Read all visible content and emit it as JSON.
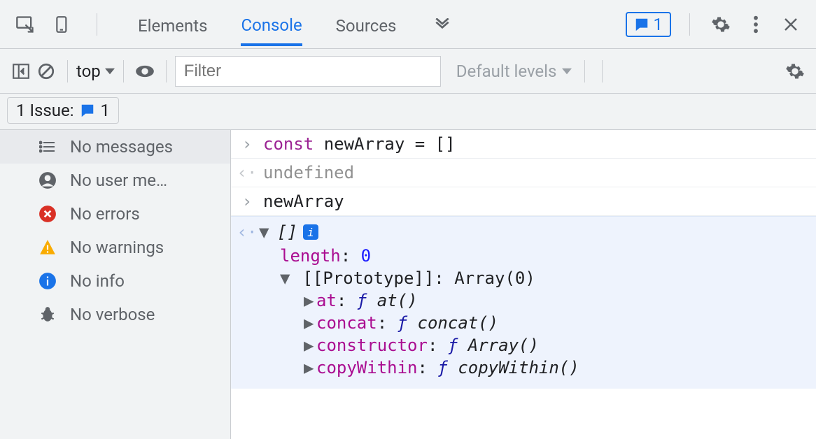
{
  "topbar": {
    "tabs": {
      "elements": "Elements",
      "console": "Console",
      "sources": "Sources"
    },
    "issues_count": "1"
  },
  "toolbar": {
    "context": "top",
    "filter_placeholder": "Filter",
    "levels_label": "Default levels"
  },
  "issuebar": {
    "label": "1 Issue:",
    "count": "1"
  },
  "sidebar": {
    "items": [
      {
        "label": "No messages"
      },
      {
        "label": "No user me…"
      },
      {
        "label": "No errors"
      },
      {
        "label": "No warnings"
      },
      {
        "label": "No info"
      },
      {
        "label": "No verbose"
      }
    ]
  },
  "console": {
    "input1_kw": "const",
    "input1_rest": " newArray = []",
    "return1": "undefined",
    "input2": "newArray",
    "eval_head": "[]",
    "length_key": "length",
    "length_val": "0",
    "proto_key": "[[Prototype]]",
    "proto_val": "Array(0)",
    "methods": [
      {
        "name": "at",
        "sig": "at()"
      },
      {
        "name": "concat",
        "sig": "concat()"
      },
      {
        "name": "constructor",
        "sig": "Array()"
      },
      {
        "name": "copyWithin",
        "sig": "copyWithin()"
      }
    ]
  }
}
